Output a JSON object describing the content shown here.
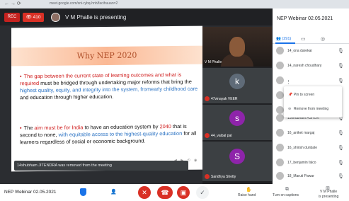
{
  "browser": {
    "url": "meet.google.com/sni-rybq-hnh/facihuuan=2"
  },
  "meet_top": {
    "rec_label": "REC",
    "participant_count": "410",
    "presenting_text": "V M Phalle is presenting"
  },
  "slide": {
    "title": "Why NEP 2020",
    "bullet1": {
      "p1": "The gap between the current state of learning outcomes and ",
      "p2": "what is required",
      "p3": " must be bridged through undertaking major reforms that bring the ",
      "p4": "highest quality, equity, and integrity into the system, fromearly childhood care",
      "p5": " and education through higher education."
    },
    "bullet2": {
      "p1": "The ",
      "p2": "aim must be for India",
      "p3": " to have an education system by ",
      "p4": "2040",
      "p5": " that is second to none, ",
      "p6": "with equitable access to the highest-quality education",
      "p7": " for all learners regardless of social or economic background."
    }
  },
  "toast": "14shubham JITENDRA was removed from the meeting",
  "tiles": [
    {
      "name": "V M Phalle"
    },
    {
      "initial": "k",
      "name": "47vinayak VEER"
    },
    {
      "initial": "s",
      "name": "44_vaibal pal"
    },
    {
      "initial": "S",
      "name": "Sandhya Shetty"
    }
  ],
  "panel": {
    "title": "NEP Webinar 02.05.2021",
    "people_tab": "(291)",
    "participants": [
      "14_ona darekar",
      "14_naresh choudhary",
      "",
      "",
      "",
      "15shubham ASHOK",
      "16_aniket margaj",
      "16_shirish dunbale",
      "17_benjamin falco",
      "18_Maruti Pawar"
    ],
    "menu": {
      "pin": "Pin to screen",
      "remove": "Remove from meeting"
    }
  },
  "bottom": {
    "meeting_name": "NEP Webinar 02.05.2021",
    "raise_hand": "Raise hand",
    "captions": "Turn on captions",
    "presenting_line1": "V M Phalle",
    "presenting_line2": "is presenting"
  }
}
